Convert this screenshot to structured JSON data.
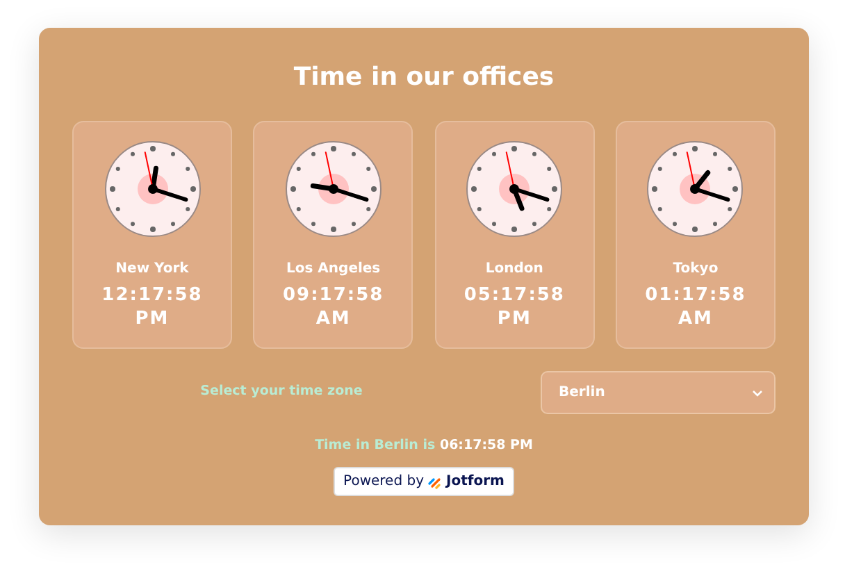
{
  "title": "Time in our offices",
  "offices": [
    {
      "city": "New York",
      "time": "12:17:58",
      "period": "PM"
    },
    {
      "city": "Los Angeles",
      "time": "09:17:58",
      "period": "AM"
    },
    {
      "city": "London",
      "time": "05:17:58",
      "period": "PM"
    },
    {
      "city": "Tokyo",
      "time": "01:17:58",
      "period": "AM"
    }
  ],
  "timezone": {
    "label": "Select your time zone",
    "value": "Berlin"
  },
  "result": "Time in Berlin is **06:17:58 PM**",
  "badge": {
    "prefix": "Powered by",
    "brand": "Jotform"
  }
}
